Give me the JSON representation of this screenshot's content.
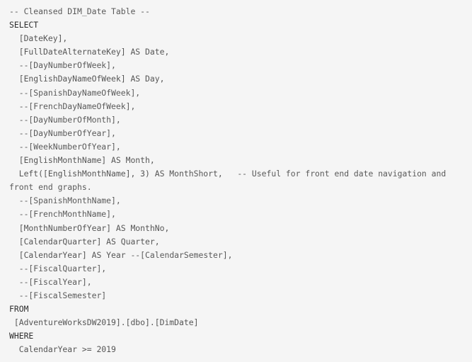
{
  "code_block": {
    "lines": [
      [
        {
          "t": "-- Cleansed DIM_Date Table --",
          "k": "comment"
        }
      ],
      [
        {
          "t": "SELECT",
          "k": "keyword"
        }
      ],
      [
        {
          "t": "  [DateKey],",
          "k": "ident"
        }
      ],
      [
        {
          "t": "  [FullDateAlternateKey] AS Date,",
          "k": "ident"
        }
      ],
      [
        {
          "t": "  --[DayNumberOfWeek],",
          "k": "comment"
        }
      ],
      [
        {
          "t": "  [EnglishDayNameOfWeek] AS Day,",
          "k": "ident"
        }
      ],
      [
        {
          "t": "  --[SpanishDayNameOfWeek],",
          "k": "comment"
        }
      ],
      [
        {
          "t": "  --[FrenchDayNameOfWeek],",
          "k": "comment"
        }
      ],
      [
        {
          "t": "  --[DayNumberOfMonth],",
          "k": "comment"
        }
      ],
      [
        {
          "t": "  --[DayNumberOfYear],",
          "k": "comment"
        }
      ],
      [
        {
          "t": "  --[WeekNumberOfYear],",
          "k": "comment"
        }
      ],
      [
        {
          "t": "  [EnglishMonthName] AS Month,",
          "k": "ident"
        }
      ],
      [
        {
          "t": "  Left([EnglishMonthName], 3) AS MonthShort,   ",
          "k": "ident"
        },
        {
          "t": "-- Useful for front end date navigation and",
          "k": "comment"
        }
      ],
      [
        {
          "t": "front end graphs.",
          "k": "comment"
        }
      ],
      [
        {
          "t": "  --[SpanishMonthName],",
          "k": "comment"
        }
      ],
      [
        {
          "t": "  --[FrenchMonthName],",
          "k": "comment"
        }
      ],
      [
        {
          "t": "  [MonthNumberOfYear] AS MonthNo,",
          "k": "ident"
        }
      ],
      [
        {
          "t": "  [CalendarQuarter] AS Quarter,",
          "k": "ident"
        }
      ],
      [
        {
          "t": "  [CalendarYear] AS Year ",
          "k": "ident"
        },
        {
          "t": "--[CalendarSemester],",
          "k": "comment"
        }
      ],
      [
        {
          "t": "  --[FiscalQuarter],",
          "k": "comment"
        }
      ],
      [
        {
          "t": "  --[FiscalYear],",
          "k": "comment"
        }
      ],
      [
        {
          "t": "  --[FiscalSemester]",
          "k": "comment"
        }
      ],
      [
        {
          "t": "FROM",
          "k": "keyword"
        }
      ],
      [
        {
          "t": " [AdventureWorksDW2019].[dbo].[DimDate]",
          "k": "ident"
        }
      ],
      [
        {
          "t": "WHERE",
          "k": "keyword"
        }
      ],
      [
        {
          "t": "  CalendarYear >= 2019",
          "k": "ident"
        }
      ]
    ]
  }
}
